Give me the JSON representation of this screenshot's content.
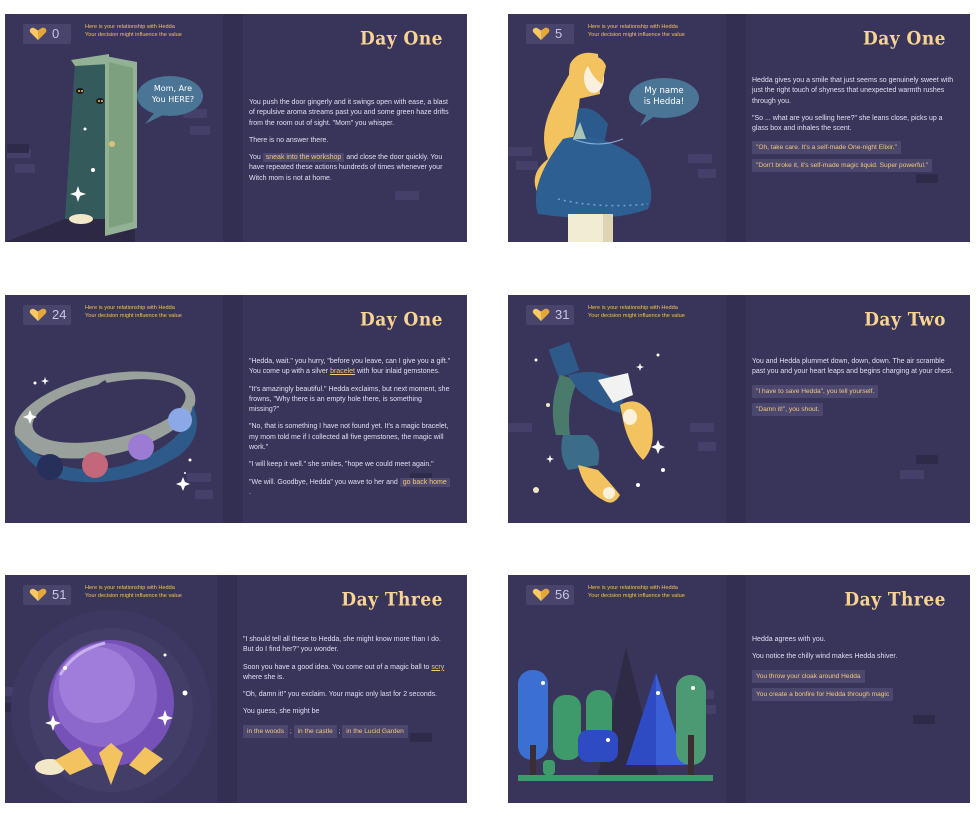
{
  "relationship_lines": [
    "Here is your relationship with Hedda",
    "Your decision might influence the value"
  ],
  "panels": [
    {
      "score": "0",
      "day": "Day One",
      "bubble": [
        "Mom, Are",
        "You HERE?"
      ],
      "p1": "You push the door gingerly and it swings open with ease, a blast of repulsive aroma streams past you and some green haze drifts from the room out of sight. \"Mom\" you whisper.",
      "p2": "There is no answer there.",
      "p3_pre": "You",
      "p3_choice": "sneak into the workshop",
      "p3_post": "and close the door quickly. You have repeated these actions hundreds of times whenever your Witch mom is not at home."
    },
    {
      "score": "5",
      "day": "Day One",
      "bubble": [
        "My name",
        "is Hedda!"
      ],
      "p1": "Hedda gives you a smile that just seems so genuinely sweet with just the right touch of shyness that unexpected warmth rushes through you.",
      "p2": "\"So ... what are you selling here?\" she leans close, picks up a glass box and inhales the scent.",
      "c1": "\"Oh, take care. It's a self-made One-night Elixir.\"",
      "c2": "\"Don't broke it, it's self-made magic liquid. Super powerful.\""
    },
    {
      "score": "24",
      "day": "Day One",
      "p1": "\"Hedda, wait.\" you hurry, \"before you leave, can I give you a gift.\"",
      "p1b_pre": "You come up with a silver",
      "p1b_link": "bracelet",
      "p1b_post": "with four inlaid gemstones.",
      "p2": "\"It's amazingly beautiful.\" Hedda exclaims, but next moment, she frowns, \"Why there is an empty hole there, is something missing?\"",
      "p3": "\"No, that is something I have not found yet. It's a magic bracelet, my mom told me if I collected all five gemstones, the magic will work.\"",
      "p4": "\"I will keep it well.\" she smiles, \"hope we could meet again.\"",
      "p5_pre": "\"We will. Goodbye, Hedda\" you wave to her and",
      "p5_choice": "go back home",
      "p5_post": "."
    },
    {
      "score": "31",
      "day": "Day Two",
      "p1": "You and Hedda plummet down, down, down. The air scramble past you and your heart leaps and begins charging at your chest.",
      "c1": "\"I have to save Hedda\", you tell yourself.",
      "c2": "\"Damn it!\", you shout."
    },
    {
      "score": "51",
      "day": "Day Three",
      "p1": "\"I should tell all these to Hedda, she might know more than I do. But do I find her?\" you wonder.",
      "p2_pre": "Soon you have a good idea. You come out of a magic ball to",
      "p2_link": "scry",
      "p2_post": "where she is.",
      "p3": "\"Oh, damn it!\" you exclaim. Your magic only last for 2 seconds.",
      "p4": "You guess, she might be",
      "o1": "in the woods",
      "o2": "in the castle",
      "o3": "in the Lucid Garden",
      "sep": ";"
    },
    {
      "score": "56",
      "day": "Day Three",
      "p1": "Hedda agrees with you.",
      "p2": "You notice the chilly wind makes Hedda shiver.",
      "c1": "You throw your cloak around Hedda",
      "c2": "You create a bonfire for Hedda through magic"
    }
  ],
  "colors": {
    "panel_bg": "#39345a",
    "accent": "#f2c35e",
    "text": "#e1def2"
  }
}
